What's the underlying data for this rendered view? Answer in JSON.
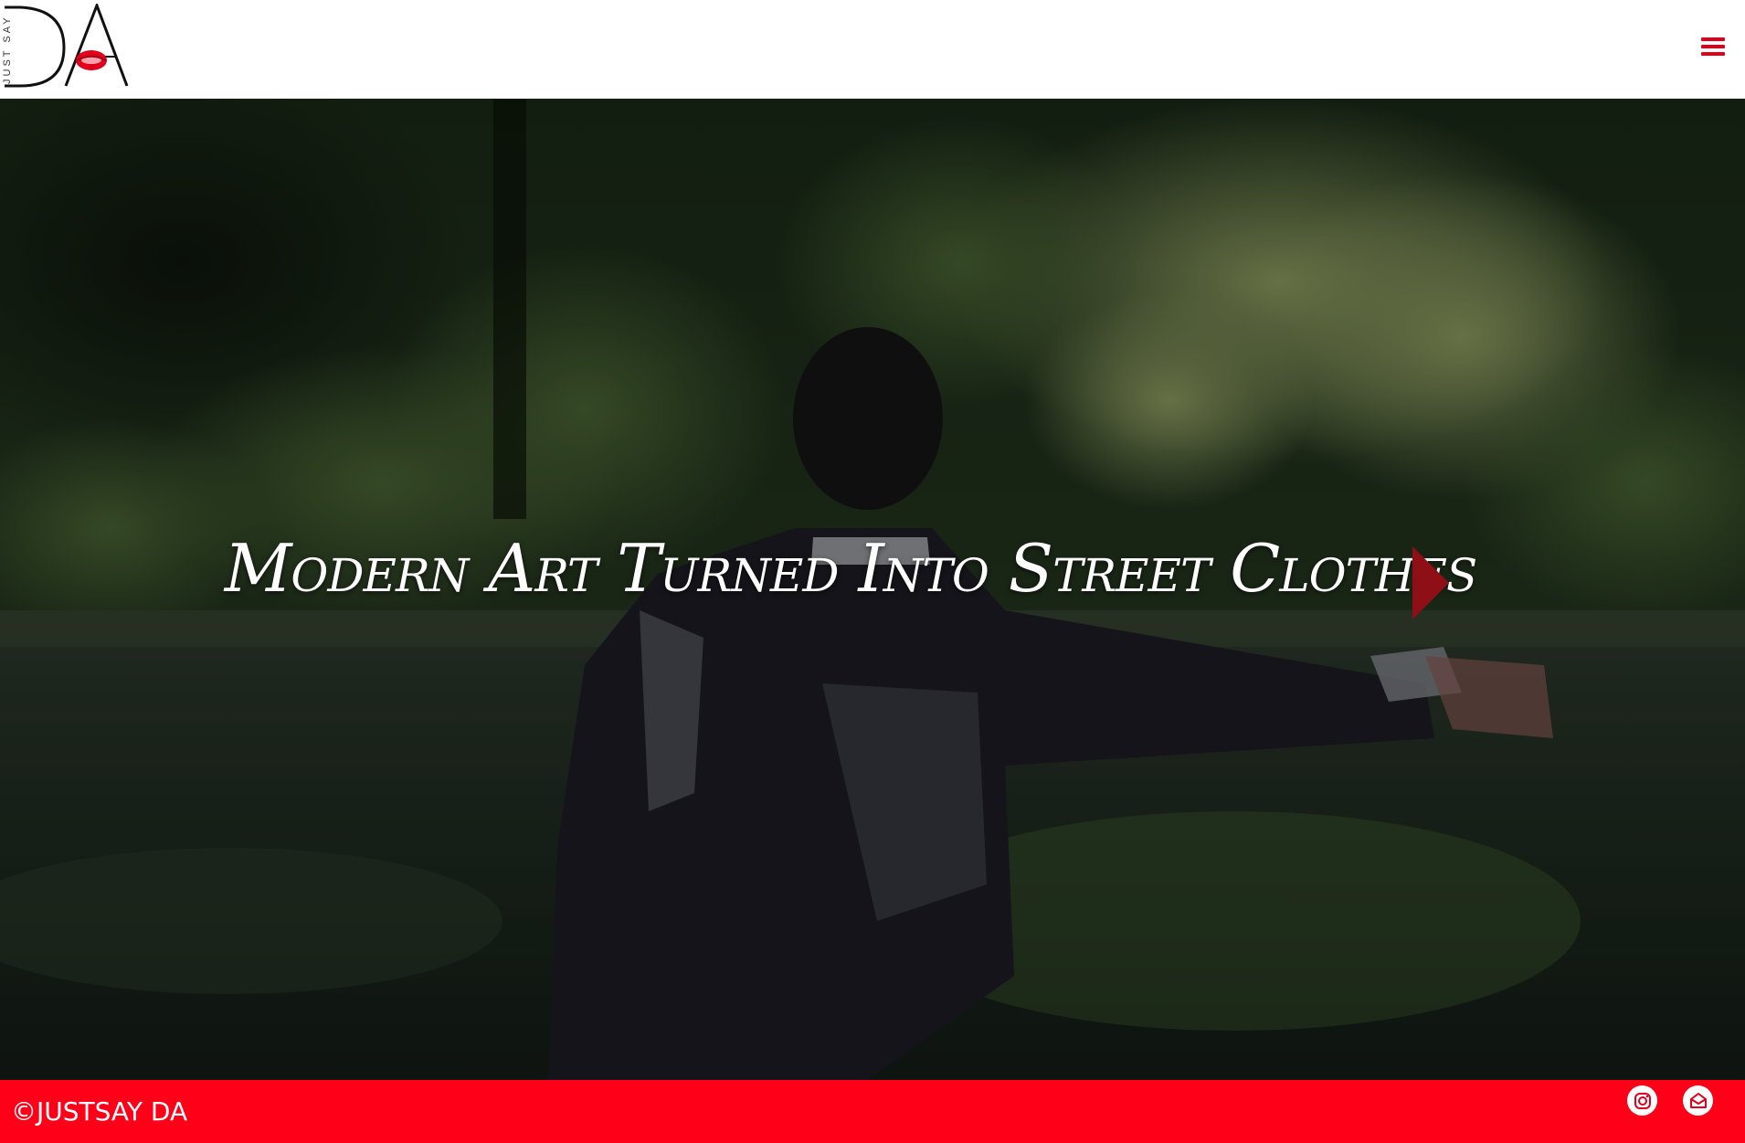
{
  "header": {
    "logo_text": "JUST SAY DA",
    "menu_icon": "hamburger-menu-icon"
  },
  "hero": {
    "headline": "Modern Art Turned Into Street Clothes",
    "play_icon": "play-arrow-icon"
  },
  "footer": {
    "copyright": "©JUSTSAY DA",
    "social": [
      {
        "name": "instagram",
        "icon": "instagram-icon"
      },
      {
        "name": "email",
        "icon": "mail-icon"
      }
    ]
  },
  "colors": {
    "accent": "#ff0019",
    "play": "#8e0f16",
    "header_bg": "#ffffff"
  }
}
